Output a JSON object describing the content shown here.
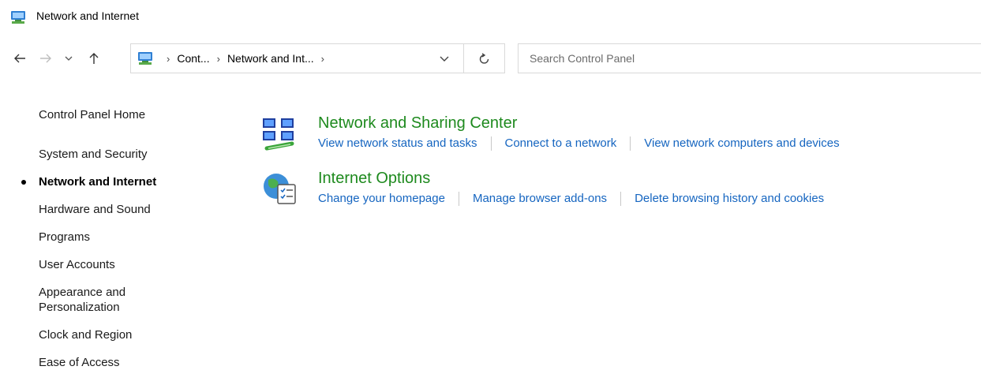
{
  "window": {
    "title": "Network and Internet"
  },
  "nav": {
    "back_icon": "back-arrow-icon",
    "forward_icon": "forward-arrow-icon",
    "recent_icon": "chevron-down-icon",
    "up_icon": "up-arrow-icon"
  },
  "address": {
    "crumbs": [
      "Cont...",
      "Network and Int..."
    ],
    "dropdown_icon": "chevron-down-icon",
    "refresh_icon": "refresh-icon"
  },
  "search": {
    "placeholder": "Search Control Panel",
    "value": ""
  },
  "sidebar": {
    "items": [
      {
        "label": "Control Panel Home",
        "active": false
      },
      {
        "label": "System and Security",
        "active": false
      },
      {
        "label": "Network and Internet",
        "active": true
      },
      {
        "label": "Hardware and Sound",
        "active": false
      },
      {
        "label": "Programs",
        "active": false
      },
      {
        "label": "User Accounts",
        "active": false
      },
      {
        "label": "Appearance and\nPersonalization",
        "active": false
      },
      {
        "label": "Clock and Region",
        "active": false
      },
      {
        "label": "Ease of Access",
        "active": false
      }
    ]
  },
  "categories": [
    {
      "title": "Network and Sharing Center",
      "icon": "network-sharing-icon",
      "links": [
        "View network status and tasks",
        "Connect to a network",
        "View network computers and devices"
      ]
    },
    {
      "title": "Internet Options",
      "icon": "internet-options-icon",
      "links": [
        "Change your homepage",
        "Manage browser add-ons",
        "Delete browsing history and cookies"
      ]
    }
  ],
  "colors": {
    "category_title": "#1e8a1e",
    "link": "#1565c0",
    "border": "#d9d9d9"
  }
}
